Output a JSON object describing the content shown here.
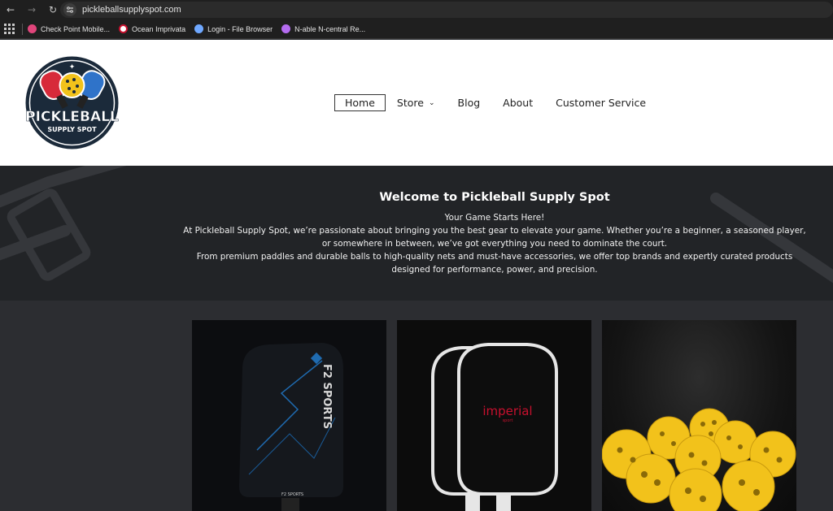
{
  "browser": {
    "url": "pickleballsupplyspot.com",
    "bookmarks": [
      {
        "label": "Check Point Mobile...",
        "color": "#e0457b"
      },
      {
        "label": "Ocean Imprivata",
        "color": "#ffffff"
      },
      {
        "label": "Login - File Browser",
        "color": "#6fa8ff"
      },
      {
        "label": "N-able N-central Re...",
        "color": "#b46cf0"
      }
    ]
  },
  "header": {
    "logo_text": {
      "line1": "PICKLEBALL",
      "line2": "SUPPLY SPOT"
    },
    "menu": [
      {
        "label": "Home",
        "active": true
      },
      {
        "label": "Store",
        "has_dropdown": true
      },
      {
        "label": "Blog"
      },
      {
        "label": "About"
      },
      {
        "label": "Customer Service"
      }
    ]
  },
  "hero": {
    "title": "Welcome to Pickleball Supply Spot",
    "lines": [
      "Your Game Starts Here!",
      "At Pickleball Supply Spot, we’re passionate about bringing you the best gear to elevate your game. Whether you’re a beginner, a seasoned player,",
      "or somewhere in between, we’ve got everything you need to dominate the court.",
      "From premium paddles and durable balls to high-quality nets and must-have accessories, we offer top brands and expertly curated products",
      "designed for performance, power, and precision."
    ]
  },
  "products": {
    "card1_text": {
      "brand": "F2 SPORTS",
      "small": "F2 SPORTS"
    },
    "card2_text": {
      "brand": "imperial",
      "sub": "sport"
    }
  },
  "colors": {
    "accent_red": "#c8102e",
    "ball_yellow": "#f2c21b",
    "hero_bg": "#222427"
  }
}
